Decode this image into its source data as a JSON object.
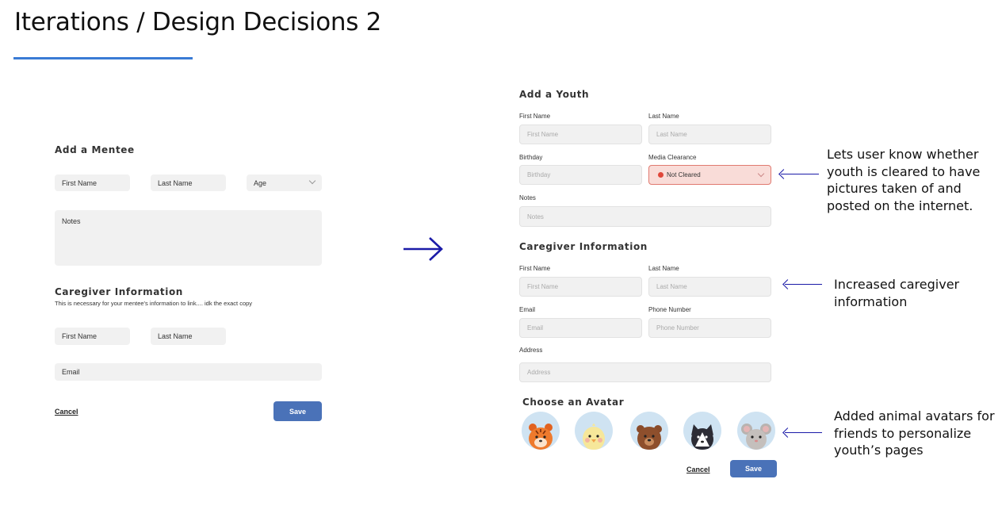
{
  "slide": {
    "title": "Iterations / Design Decisions 2"
  },
  "old_form": {
    "title": "Add a Mentee",
    "first_name": "First Name",
    "last_name": "Last Name",
    "age": "Age",
    "notes": "Notes",
    "caregiver_title": "Caregiver Information",
    "caregiver_subtitle": "This is necessary for your mentee's information to link.... idk the exact copy",
    "cg_first_name": "First Name",
    "cg_last_name": "Last Name",
    "email": "Email",
    "cancel": "Cancel",
    "save": "Save"
  },
  "new_form": {
    "title": "Add a Youth",
    "first_name_label": "First Name",
    "first_name_placeholder": "First Name",
    "last_name_label": "Last Name",
    "last_name_placeholder": "Last Name",
    "birthday_label": "Birthday",
    "birthday_placeholder": "Birthday",
    "media_label": "Media Clearance",
    "media_value": "Not Cleared",
    "notes_label": "Notes",
    "notes_placeholder": "Notes",
    "caregiver_title": "Caregiver Information",
    "cg_first_name_label": "First Name",
    "cg_first_name_placeholder": "First Name",
    "cg_last_name_label": "Last Name",
    "cg_last_name_placeholder": "Last Name",
    "email_label": "Email",
    "email_placeholder": "Email",
    "phone_label": "Phone Number",
    "phone_placeholder": "Phone Number",
    "address_label": "Address",
    "address_placeholder": "Address",
    "avatar_title": "Choose an Avatar",
    "avatars": [
      "tiger",
      "chick",
      "bear",
      "husky",
      "mouse"
    ],
    "cancel": "Cancel",
    "save": "Save"
  },
  "annotations": {
    "media": [
      "Lets user know whether",
      "youth is cleared to have",
      "pictures taken of and",
      "posted on the internet."
    ],
    "caregiver": [
      "Increased caregiver",
      "information"
    ],
    "avatars": [
      "Added animal avatars for",
      "friends to personalize",
      "youth’s pages"
    ]
  },
  "colors": {
    "accent_underline": "#3a7bd5",
    "button": "#4a72b8",
    "arrow": "#1b1ba8",
    "status_red": "#e0473a",
    "status_bg": "#f9dcd8"
  }
}
